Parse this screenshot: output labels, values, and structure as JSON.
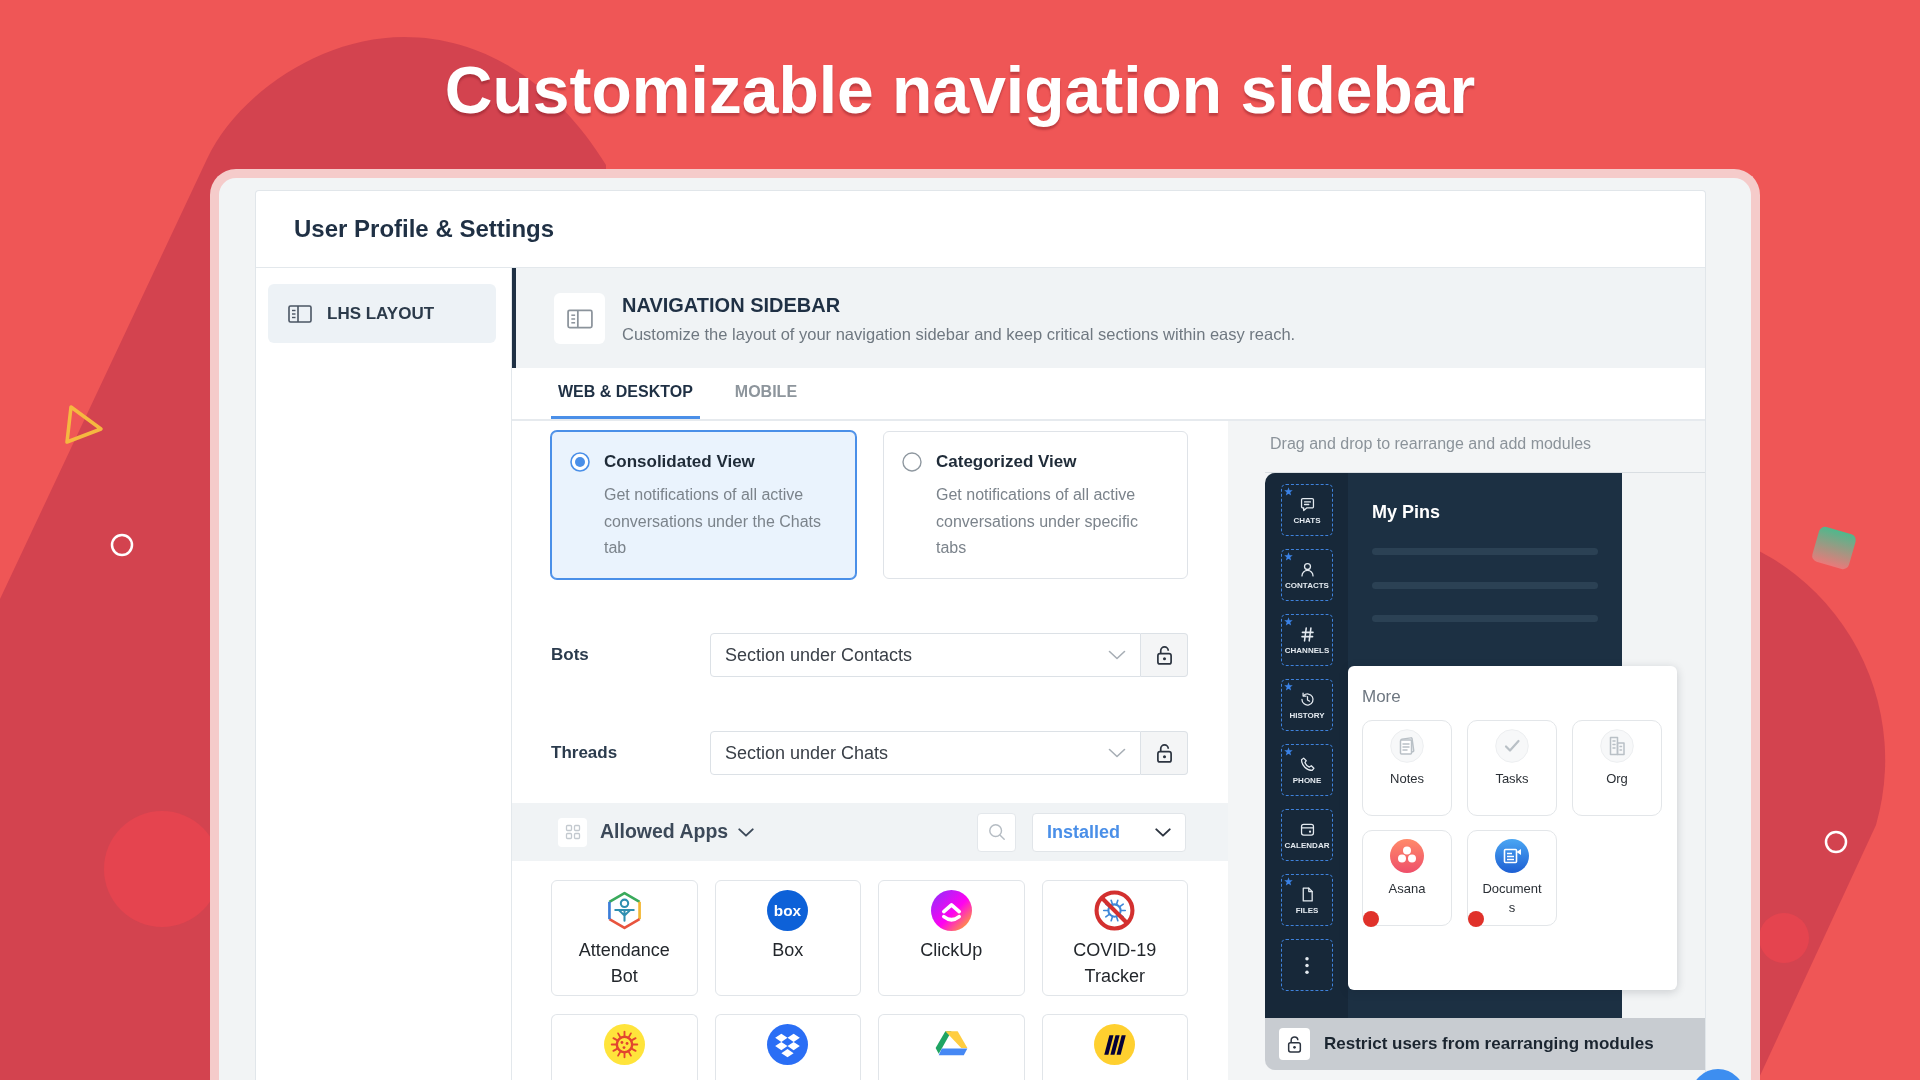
{
  "headline": "Customizable navigation sidebar",
  "settings": {
    "title": "User Profile & Settings",
    "menu": [
      {
        "label": "LHS LAYOUT",
        "selected": true
      }
    ],
    "section": {
      "title": "NAVIGATION SIDEBAR",
      "description": "Customize the layout of your navigation sidebar and keep critical sections within easy reach."
    },
    "tabs": [
      {
        "label": "WEB & DESKTOP",
        "selected": true
      },
      {
        "label": "MOBILE",
        "selected": false
      }
    ],
    "view_options": [
      {
        "title": "Consolidated View",
        "description": "Get notifications of all active conversations under the Chats tab",
        "selected": true
      },
      {
        "title": "Categorized View",
        "description": "Get notifications of all active conversations under specific tabs",
        "selected": false
      }
    ],
    "placements": [
      {
        "label": "Bots",
        "value": "Section under Contacts",
        "locked": false
      },
      {
        "label": "Threads",
        "value": "Section under Chats",
        "locked": false
      }
    ],
    "allowed_apps": {
      "title": "Allowed Apps",
      "filter": "Installed",
      "apps": [
        {
          "name": "Attendance Bot",
          "kind": "attendance"
        },
        {
          "name": "Box",
          "kind": "box",
          "logo_text": "box"
        },
        {
          "name": "ClickUp",
          "kind": "clickup"
        },
        {
          "name": "COVID-19 Tracker",
          "kind": "covidtracker"
        },
        {
          "kind": "virus"
        },
        {
          "kind": "dropbox"
        },
        {
          "kind": "drive"
        },
        {
          "kind": "miro"
        }
      ]
    }
  },
  "preview": {
    "hint": "Drag and drop to rearrange and add modules",
    "modules": [
      {
        "label": "CHATS",
        "kind": "chats",
        "starred": true
      },
      {
        "label": "CONTACTS",
        "kind": "contacts",
        "starred": true
      },
      {
        "label": "CHANNELS",
        "kind": "channels",
        "starred": true
      },
      {
        "label": "HISTORY",
        "kind": "history",
        "starred": true
      },
      {
        "label": "PHONE",
        "kind": "phone",
        "starred": true
      },
      {
        "label": "CALENDAR",
        "kind": "calendar",
        "starred": false
      },
      {
        "label": "FILES",
        "kind": "files",
        "starred": true
      },
      {
        "kind": "more",
        "starred": false
      }
    ],
    "pins_title": "My Pins",
    "more": {
      "title": "More",
      "items": [
        {
          "label": "Notes",
          "kind": "notes",
          "marked": false
        },
        {
          "label": "Tasks",
          "kind": "tasks",
          "marked": false
        },
        {
          "label": "Org",
          "kind": "org",
          "marked": false
        },
        {
          "label": "Asana",
          "kind": "asana",
          "marked": true
        },
        {
          "label": "Documents",
          "kind": "documents",
          "marked": true
        }
      ]
    },
    "restrict": {
      "label": "Restrict users from rearranging modules",
      "locked": false
    }
  }
}
